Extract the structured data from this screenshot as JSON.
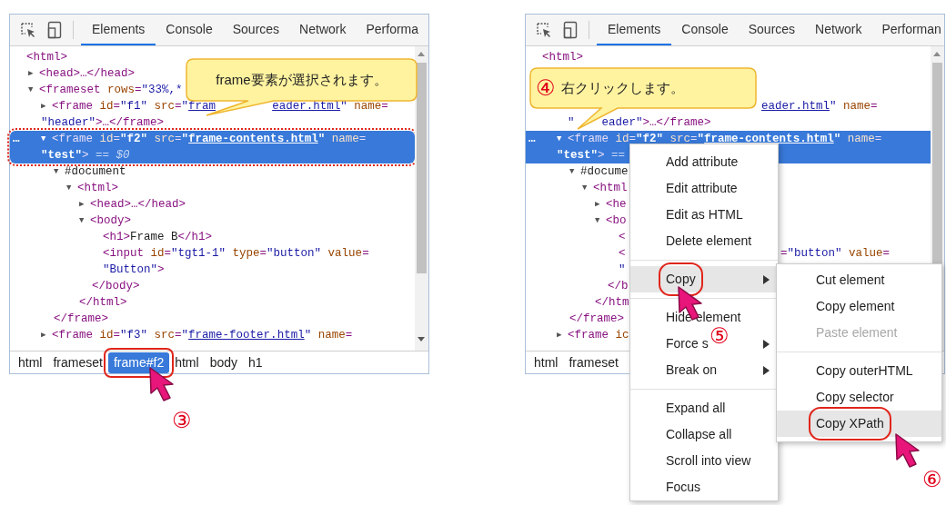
{
  "panels": [
    {
      "tabs": [
        {
          "label": "Elements",
          "selected": true
        },
        {
          "label": "Console",
          "selected": false
        },
        {
          "label": "Sources",
          "selected": false
        },
        {
          "label": "Network",
          "selected": false
        },
        {
          "label": "Performa",
          "selected": false
        }
      ],
      "tree": [
        {
          "selected": false,
          "lines": [
            [
              {
                "kind": "tag",
                "text": "<html>"
              }
            ]
          ],
          "children": [
            {
              "toggle": "▶",
              "selected": false,
              "lines": [
                [
                  {
                    "kind": "tag",
                    "text": "<head>…</head>"
                  }
                ]
              ]
            },
            {
              "toggle": "▼",
              "selected": false,
              "lines": [
                [
                  {
                    "kind": "tag",
                    "text": "<frameset"
                  },
                  {
                    "kind": "attr",
                    "text": " rows"
                  },
                  {
                    "kind": "tag",
                    "text": "="
                  },
                  {
                    "kind": "val",
                    "text": "\"33%,*"
                  }
                ]
              ],
              "children": [
                {
                  "toggle": "▶",
                  "selected": false,
                  "lines": [
                    [
                      {
                        "kind": "tag",
                        "text": "<frame"
                      },
                      {
                        "kind": "attr",
                        "text": " id"
                      },
                      {
                        "kind": "tag",
                        "text": "="
                      },
                      {
                        "kind": "val",
                        "text": "\"f1\""
                      },
                      {
                        "kind": "attr",
                        "text": " src"
                      },
                      {
                        "kind": "tag",
                        "text": "="
                      },
                      {
                        "kind": "val",
                        "text": "\""
                      },
                      {
                        "kind": "link",
                        "text": "fram"
                      },
                      {
                        "kind": "gap"
                      },
                      {
                        "kind": "link",
                        "text": "eader.html"
                      },
                      {
                        "kind": "val",
                        "text": "\""
                      },
                      {
                        "kind": "attr",
                        "text": " name"
                      },
                      {
                        "kind": "tag",
                        "text": "="
                      }
                    ],
                    [
                      {
                        "kind": "val",
                        "text": "\"header\""
                      },
                      {
                        "kind": "tag",
                        "text": ">…</frame>"
                      }
                    ]
                  ]
                },
                {
                  "toggle": "▼",
                  "selected": true,
                  "marked": true,
                  "more": "…",
                  "lines": [
                    [
                      {
                        "kind": "tag",
                        "text": "<frame"
                      },
                      {
                        "kind": "attr",
                        "text": " id"
                      },
                      {
                        "kind": "tag",
                        "text": "="
                      },
                      {
                        "kind": "val",
                        "text": "\"f2\""
                      },
                      {
                        "kind": "attr",
                        "text": " src"
                      },
                      {
                        "kind": "tag",
                        "text": "="
                      },
                      {
                        "kind": "val",
                        "text": "\""
                      },
                      {
                        "kind": "link",
                        "text": "frame-contents.html"
                      },
                      {
                        "kind": "val",
                        "text": "\""
                      },
                      {
                        "kind": "attr",
                        "text": " name"
                      },
                      {
                        "kind": "tag",
                        "text": "="
                      }
                    ],
                    [
                      {
                        "kind": "val",
                        "text": "\"test\""
                      },
                      {
                        "kind": "tag",
                        "text": ">"
                      },
                      {
                        "kind": "eq",
                        "text": " == $0"
                      }
                    ]
                  ],
                  "children": [
                    {
                      "toggle": "▼",
                      "selected": false,
                      "lines": [
                        [
                          {
                            "kind": "text",
                            "text": "#document"
                          }
                        ]
                      ],
                      "children": [
                        {
                          "toggle": "▼",
                          "selected": false,
                          "lines": [
                            [
                              {
                                "kind": "tag",
                                "text": "<html>"
                              }
                            ]
                          ],
                          "children": [
                            {
                              "toggle": "▶",
                              "selected": false,
                              "lines": [
                                [
                                  {
                                    "kind": "tag",
                                    "text": "<head>…</head>"
                                  }
                                ]
                              ]
                            },
                            {
                              "toggle": "▼",
                              "selected": false,
                              "lines": [
                                [
                                  {
                                    "kind": "tag",
                                    "text": "<body>"
                                  }
                                ]
                              ],
                              "children": [
                                {
                                  "selected": false,
                                  "lines": [
                                    [
                                      {
                                        "kind": "tag",
                                        "text": "<h1>"
                                      },
                                      {
                                        "kind": "text",
                                        "text": "Frame B"
                                      },
                                      {
                                        "kind": "tag",
                                        "text": "</h1>"
                                      }
                                    ]
                                  ]
                                },
                                {
                                  "selected": false,
                                  "lines": [
                                    [
                                      {
                                        "kind": "tag",
                                        "text": "<input"
                                      },
                                      {
                                        "kind": "attr",
                                        "text": " id"
                                      },
                                      {
                                        "kind": "tag",
                                        "text": "="
                                      },
                                      {
                                        "kind": "val",
                                        "text": "\"tgt1-1\""
                                      },
                                      {
                                        "kind": "attr",
                                        "text": " type"
                                      },
                                      {
                                        "kind": "tag",
                                        "text": "="
                                      },
                                      {
                                        "kind": "val",
                                        "text": "\"button\""
                                      },
                                      {
                                        "kind": "attr",
                                        "text": " value"
                                      },
                                      {
                                        "kind": "tag",
                                        "text": "="
                                      }
                                    ],
                                    [
                                      {
                                        "kind": "val",
                                        "text": "\"Button\""
                                      },
                                      {
                                        "kind": "tag",
                                        "text": ">"
                                      }
                                    ]
                                  ]
                                }
                              ],
                              "close": [
                                {
                                  "kind": "tag",
                                  "text": "</body>"
                                }
                              ]
                            }
                          ],
                          "close": [
                            {
                              "kind": "tag",
                              "text": "</html>"
                            }
                          ]
                        }
                      ]
                    }
                  ],
                  "close": [
                    {
                      "kind": "tag",
                      "text": "</frame>"
                    }
                  ]
                },
                {
                  "toggle": "▶",
                  "selected": false,
                  "lines": [
                    [
                      {
                        "kind": "tag",
                        "text": "<frame"
                      },
                      {
                        "kind": "attr",
                        "text": " id"
                      },
                      {
                        "kind": "tag",
                        "text": "="
                      },
                      {
                        "kind": "val",
                        "text": "\"f3\""
                      },
                      {
                        "kind": "attr",
                        "text": " src"
                      },
                      {
                        "kind": "tag",
                        "text": "="
                      },
                      {
                        "kind": "val",
                        "text": "\""
                      },
                      {
                        "kind": "link",
                        "text": "frame-footer.html"
                      },
                      {
                        "kind": "val",
                        "text": "\""
                      },
                      {
                        "kind": "attr",
                        "text": " name"
                      },
                      {
                        "kind": "tag",
                        "text": "="
                      }
                    ]
                  ]
                }
              ]
            }
          ]
        }
      ],
      "callout": {
        "text": "frame要素が選択されます。"
      },
      "breadcrumbs": [
        {
          "label": "html",
          "selected": false
        },
        {
          "label": "frameset",
          "selected": false
        },
        {
          "label": "frame#f2",
          "selected": true,
          "marked": true,
          "step": "③"
        },
        {
          "label": "html",
          "selected": false
        },
        {
          "label": "body",
          "selected": false
        },
        {
          "label": "h1",
          "selected": false
        }
      ]
    },
    {
      "tabs": [
        {
          "label": "Elements",
          "selected": true
        },
        {
          "label": "Console",
          "selected": false
        },
        {
          "label": "Sources",
          "selected": false
        },
        {
          "label": "Network",
          "selected": false
        },
        {
          "label": "Performan",
          "selected": false
        }
      ],
      "tree": [
        {
          "selected": false,
          "lines": [
            [
              {
                "kind": "tag",
                "text": "<html>"
              }
            ]
          ],
          "children": [
            {
              "selected": false,
              "lines": [
                [
                  {
                    "kind": "callout"
                  }
                ]
              ]
            },
            {
              "selected": false,
              "lines": [
                [
                  {
                    "kind": "callout"
                  }
                ]
              ],
              "children": [
                {
                  "selected": false,
                  "lines": [
                    [
                      {
                        "kind": "callout"
                      },
                      {
                        "kind": "link",
                        "text": "eader.html"
                      },
                      {
                        "kind": "val",
                        "text": "\""
                      },
                      {
                        "kind": "attr",
                        "text": " name"
                      },
                      {
                        "kind": "tag",
                        "text": "="
                      }
                    ],
                    [
                      {
                        "kind": "val",
                        "text": "\""
                      },
                      {
                        "kind": "gap"
                      },
                      {
                        "kind": "val",
                        "text": "eader\""
                      },
                      {
                        "kind": "tag",
                        "text": ">…</frame>"
                      }
                    ]
                  ]
                },
                {
                  "toggle": "▼",
                  "selected": true,
                  "more": "…",
                  "lines": [
                    [
                      {
                        "kind": "tag",
                        "text": "<frame"
                      },
                      {
                        "kind": "attr",
                        "text": " id"
                      },
                      {
                        "kind": "tag",
                        "text": "="
                      },
                      {
                        "kind": "val",
                        "text": "\"f2\""
                      },
                      {
                        "kind": "attr",
                        "text": " src"
                      },
                      {
                        "kind": "tag",
                        "text": "="
                      },
                      {
                        "kind": "val",
                        "text": "\""
                      },
                      {
                        "kind": "link",
                        "text": "frame-contents.html"
                      },
                      {
                        "kind": "val",
                        "text": "\""
                      },
                      {
                        "kind": "attr",
                        "text": " name"
                      },
                      {
                        "kind": "tag",
                        "text": "="
                      }
                    ],
                    [
                      {
                        "kind": "val",
                        "text": "\"test\""
                      },
                      {
                        "kind": "tag",
                        "text": ">"
                      },
                      {
                        "kind": "eq",
                        "text": " =="
                      }
                    ]
                  ],
                  "children": [
                    {
                      "toggle": "▼",
                      "selected": false,
                      "lines": [
                        [
                          {
                            "kind": "text",
                            "text": "#docume"
                          }
                        ]
                      ],
                      "children": [
                        {
                          "toggle": "▼",
                          "selected": false,
                          "lines": [
                            [
                              {
                                "kind": "tag",
                                "text": "<html"
                              }
                            ]
                          ],
                          "children": [
                            {
                              "toggle": "▶",
                              "selected": false,
                              "lines": [
                                [
                                  {
                                    "kind": "tag",
                                    "text": "<he"
                                  }
                                ]
                              ]
                            },
                            {
                              "toggle": "▼",
                              "selected": false,
                              "lines": [
                                [
                                  {
                                    "kind": "tag",
                                    "text": "<bo"
                                  }
                                ]
                              ],
                              "children": [
                                {
                                  "selected": false,
                                  "lines": [
                                    [
                                      {
                                        "kind": "tag",
                                        "text": "<"
                                      }
                                    ]
                                  ]
                                },
                                {
                                  "selected": false,
                                  "lines": [
                                    [
                                      {
                                        "kind": "tag",
                                        "text": "<"
                                      },
                                      {
                                        "kind": "menu"
                                      },
                                      {
                                        "kind": "tag",
                                        "text": "="
                                      },
                                      {
                                        "kind": "val",
                                        "text": "\"button\""
                                      },
                                      {
                                        "kind": "attr",
                                        "text": " value"
                                      },
                                      {
                                        "kind": "tag",
                                        "text": "="
                                      }
                                    ],
                                    [
                                      {
                                        "kind": "val",
                                        "text": "\""
                                      }
                                    ]
                                  ]
                                }
                              ],
                              "close": [
                                {
                                  "kind": "tag",
                                  "text": "</b"
                                }
                              ]
                            }
                          ],
                          "close": [
                            {
                              "kind": "tag",
                              "text": "</htm"
                            }
                          ]
                        }
                      ]
                    }
                  ],
                  "close": [
                    {
                      "kind": "tag",
                      "text": "</frame>"
                    }
                  ]
                },
                {
                  "toggle": "▶",
                  "selected": false,
                  "lines": [
                    [
                      {
                        "kind": "tag",
                        "text": "<frame"
                      },
                      {
                        "kind": "attr",
                        "text": " ic"
                      }
                    ]
                  ]
                }
              ]
            }
          ]
        }
      ],
      "callout": {
        "number": "④",
        "text": "右クリックします。"
      },
      "breadcrumbs": [
        {
          "label": "html",
          "selected": false
        },
        {
          "label": "frameset",
          "selected": false
        }
      ],
      "context_menu": {
        "items": [
          {
            "kind": "item",
            "label": "Add attribute",
            "highlighted": false,
            "has_submenu": false
          },
          {
            "kind": "item",
            "label": "Edit attribute",
            "highlighted": false,
            "has_submenu": false
          },
          {
            "kind": "item",
            "label": "Edit as HTML",
            "highlighted": false,
            "has_submenu": false
          },
          {
            "kind": "item",
            "label": "Delete element",
            "highlighted": false,
            "has_submenu": false
          },
          {
            "kind": "separator"
          },
          {
            "kind": "item",
            "label": "Copy",
            "highlighted": true,
            "has_submenu": true,
            "marked": true,
            "step": "⑤"
          },
          {
            "kind": "separator"
          },
          {
            "kind": "item",
            "label": "Hide element",
            "highlighted": false,
            "has_submenu": false
          },
          {
            "kind": "item",
            "label": "Force s",
            "highlighted": false,
            "has_submenu": true
          },
          {
            "kind": "item",
            "label": "Break on",
            "highlighted": false,
            "has_submenu": true
          },
          {
            "kind": "separator"
          },
          {
            "kind": "item",
            "label": "Expand all",
            "highlighted": false,
            "has_submenu": false
          },
          {
            "kind": "item",
            "label": "Collapse all",
            "highlighted": false,
            "has_submenu": false
          },
          {
            "kind": "item",
            "label": "Scroll into view",
            "highlighted": false,
            "has_submenu": false
          },
          {
            "kind": "item",
            "label": "Focus",
            "highlighted": false,
            "has_submenu": false
          }
        ]
      },
      "submenu": {
        "items": [
          {
            "kind": "item",
            "label": "Cut element",
            "highlighted": false,
            "disabled": false
          },
          {
            "kind": "item",
            "label": "Copy element",
            "highlighted": false,
            "disabled": false
          },
          {
            "kind": "item",
            "label": "Paste element",
            "highlighted": false,
            "disabled": true
          },
          {
            "kind": "separator"
          },
          {
            "kind": "item",
            "label": "Copy outerHTML",
            "highlighted": false,
            "disabled": false
          },
          {
            "kind": "item",
            "label": "Copy selector",
            "highlighted": false,
            "disabled": false
          },
          {
            "kind": "item",
            "label": "Copy XPath",
            "highlighted": true,
            "disabled": false,
            "marked": true,
            "step": "⑥"
          }
        ]
      }
    }
  ]
}
